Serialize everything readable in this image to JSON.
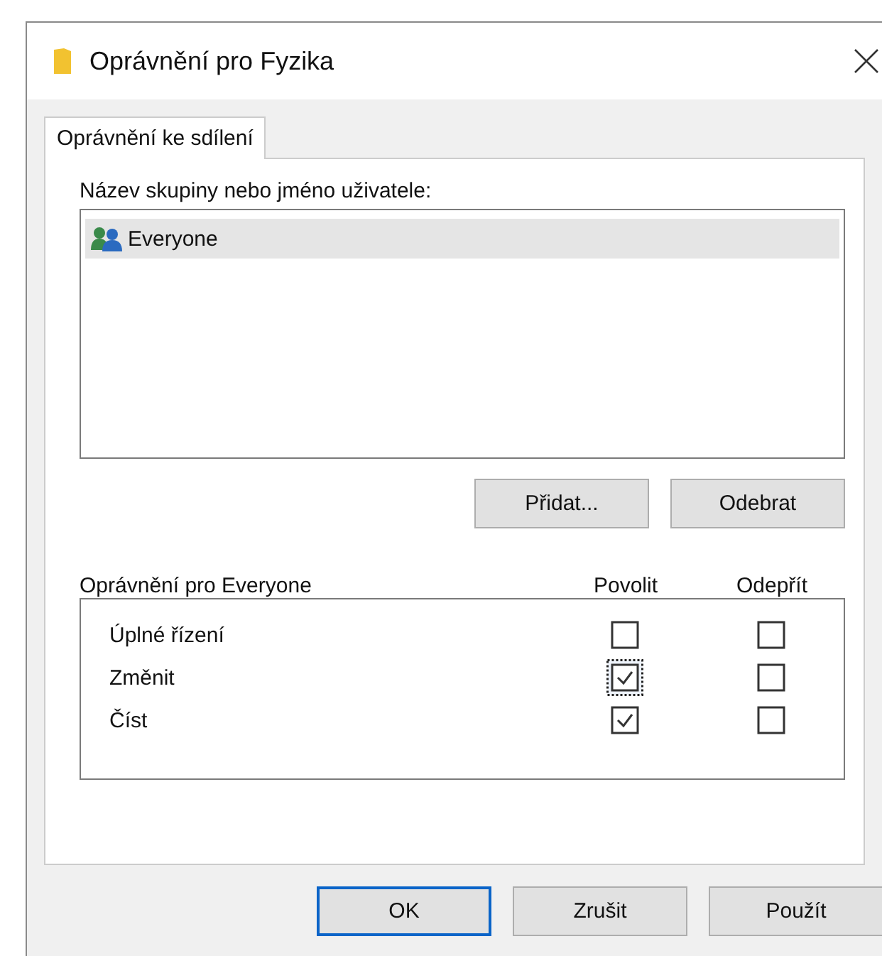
{
  "window": {
    "title": "Oprávnění pro Fyzika"
  },
  "tabs": [
    {
      "label": "Oprávnění ke sdílení",
      "selected": true
    }
  ],
  "group_list": {
    "label": "Název skupiny nebo jméno uživatele:",
    "items": [
      {
        "name": "Everyone",
        "selected": true
      }
    ]
  },
  "list_buttons": [
    "Přidat...",
    "Odebrat"
  ],
  "permissions": {
    "label": "Oprávnění pro Everyone",
    "columns": [
      "Povolit",
      "Odepřít"
    ],
    "rows": [
      {
        "name": "Úplné řízení",
        "allow": false,
        "deny": false,
        "focused": false
      },
      {
        "name": "Změnit",
        "allow": true,
        "deny": false,
        "focused": true
      },
      {
        "name": "Číst",
        "allow": true,
        "deny": false,
        "focused": false
      }
    ]
  },
  "buttons": [
    {
      "label": "OK",
      "default": true
    },
    {
      "label": "Zrušit",
      "default": false
    },
    {
      "label": "Použít",
      "default": false
    }
  ]
}
